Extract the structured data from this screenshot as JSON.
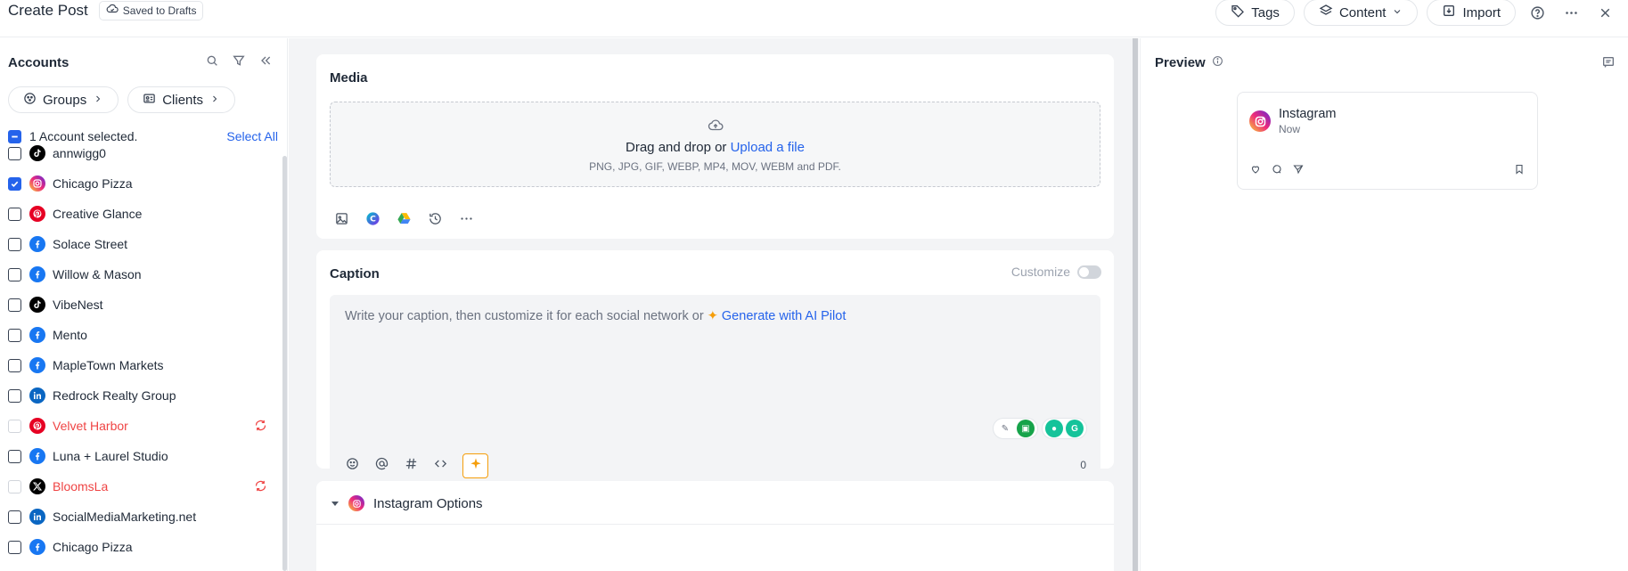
{
  "header": {
    "title": "Create Post",
    "draft_status": "Saved to Drafts",
    "actions": {
      "tags": "Tags",
      "content": "Content",
      "import": "Import"
    }
  },
  "sidebar": {
    "title": "Accounts",
    "filters": {
      "groups": "Groups",
      "clients": "Clients"
    },
    "selection_text": "1 Account selected.",
    "select_all": "Select All",
    "accounts": [
      {
        "name": "annwigg0",
        "platform": "tiktok",
        "checked": false,
        "error": false
      },
      {
        "name": "Chicago Pizza",
        "platform": "instagram",
        "checked": true,
        "error": false
      },
      {
        "name": "Creative Glance",
        "platform": "pinterest",
        "checked": false,
        "error": false
      },
      {
        "name": "Solace Street",
        "platform": "facebook",
        "checked": false,
        "error": false
      },
      {
        "name": "Willow & Mason",
        "platform": "facebook",
        "checked": false,
        "error": false
      },
      {
        "name": "VibeNest",
        "platform": "tiktok",
        "checked": false,
        "error": false
      },
      {
        "name": "Mento",
        "platform": "facebook",
        "checked": false,
        "error": false
      },
      {
        "name": "MapleTown Markets",
        "platform": "facebook",
        "checked": false,
        "error": false
      },
      {
        "name": "Redrock Realty Group",
        "platform": "linkedin",
        "checked": false,
        "error": false
      },
      {
        "name": "Velvet Harbor",
        "platform": "pinterest",
        "checked": false,
        "error": true
      },
      {
        "name": "Luna + Laurel Studio",
        "platform": "facebook",
        "checked": false,
        "error": false
      },
      {
        "name": "BloomsLa",
        "platform": "x",
        "checked": false,
        "error": true
      },
      {
        "name": "SocialMediaMarketing.net",
        "platform": "linkedin",
        "checked": false,
        "error": false
      },
      {
        "name": "Chicago Pizza",
        "platform": "facebook",
        "checked": false,
        "error": false
      }
    ]
  },
  "media": {
    "title": "Media",
    "drop_text": "Drag and drop or",
    "upload_link": "Upload a file",
    "formats": "PNG, JPG, GIF, WEBP, MP4, MOV, WEBM and PDF."
  },
  "caption": {
    "title": "Caption",
    "customize_label": "Customize",
    "placeholder": "Write your caption, then customize it for each social network or",
    "ai_link": "Generate with AI Pilot",
    "char_count": "0"
  },
  "instagram_options": {
    "title": "Instagram Options"
  },
  "preview": {
    "title": "Preview",
    "account_name": "Instagram",
    "time": "Now"
  },
  "colors": {
    "accent": "#2563eb",
    "error": "#ef4444",
    "ai": "#f59e0b",
    "facebook": "#1877f2",
    "linkedin": "#0a66c2",
    "pinterest": "#e60023",
    "tiktok": "#000000",
    "x": "#000000"
  }
}
